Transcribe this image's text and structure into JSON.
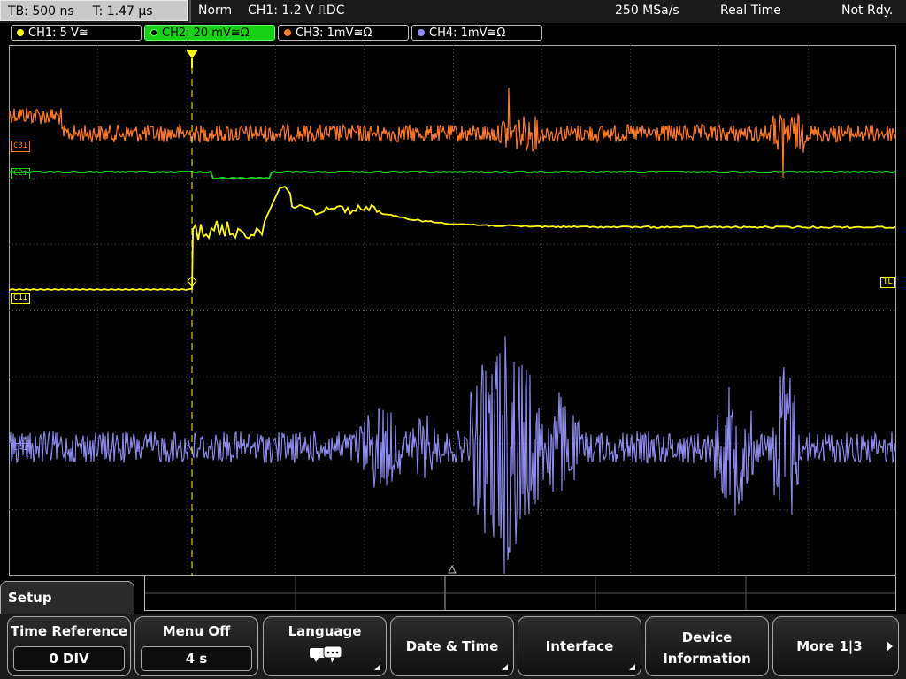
{
  "header": {
    "timebase": "TB: 500 ns",
    "time": "T: 1.47 µs",
    "mode": "Norm",
    "trigger": "CH1: 1.2 V ⎍DC",
    "sample_rate": "250 MSa/s",
    "acq_mode": "Real Time",
    "status": "Not Rdy."
  },
  "channels": [
    {
      "label": "CH1: 5 V≅",
      "color": "#ffff00"
    },
    {
      "label": "CH2: 20 mV≅Ω",
      "color": "#17d117"
    },
    {
      "label": "CH3: 1mV≅Ω",
      "color": "#ff7a20"
    },
    {
      "label": "CH4: 1mV≅Ω",
      "color": "#8f8cf0"
    }
  ],
  "markers": {
    "c3": "C3⊥",
    "c2": "C2⊥",
    "c1": "C1⊥",
    "c4": "C4⊥",
    "trigger_level": "TL"
  },
  "menu": {
    "title": "Setup",
    "softkeys": [
      {
        "label": "Time Reference",
        "value": "0 DIV"
      },
      {
        "label": "Menu Off",
        "value": "4 s"
      },
      {
        "label": "Language",
        "icon": "speech-bubble-icon"
      },
      {
        "label": "Date & Time"
      },
      {
        "label": "Interface"
      },
      {
        "label_line1": "Device",
        "label_line2": "Information"
      },
      {
        "label": "More 1|3"
      }
    ]
  }
}
